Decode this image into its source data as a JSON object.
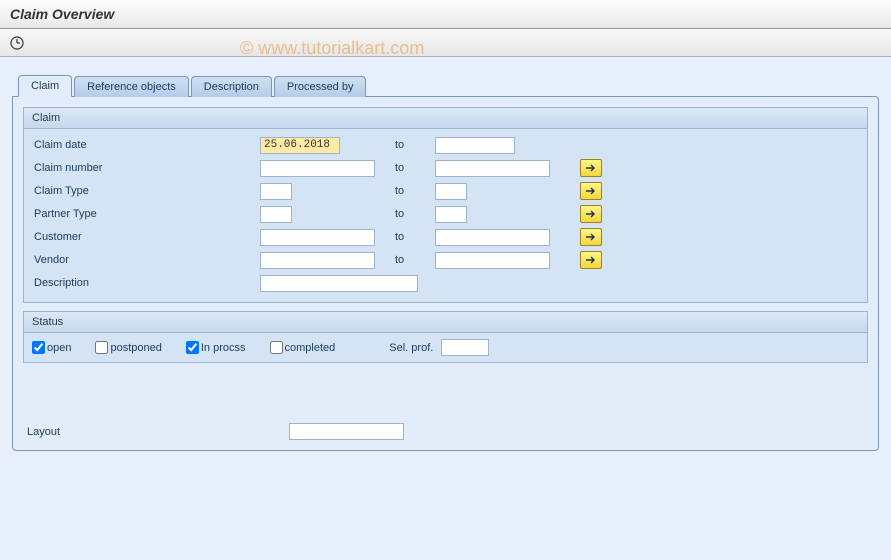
{
  "header": {
    "title": "Claim Overview"
  },
  "watermark": "© www.tutorialkart.com",
  "tabs": [
    {
      "label": "Claim",
      "active": true
    },
    {
      "label": "Reference objects",
      "active": false
    },
    {
      "label": "Description",
      "active": false
    },
    {
      "label": "Processed by",
      "active": false
    }
  ],
  "claim_group": {
    "title": "Claim",
    "fields": {
      "claim_date": {
        "label": "Claim date",
        "from": "25.06.2018",
        "to": "",
        "to_label": "to"
      },
      "claim_number": {
        "label": "Claim number",
        "from": "",
        "to": "",
        "to_label": "to"
      },
      "claim_type": {
        "label": "Claim Type",
        "from": "",
        "to": "",
        "to_label": "to"
      },
      "partner_type": {
        "label": "Partner Type",
        "from": "",
        "to": "",
        "to_label": "to"
      },
      "customer": {
        "label": "Customer",
        "from": "",
        "to": "",
        "to_label": "to"
      },
      "vendor": {
        "label": "Vendor",
        "from": "",
        "to": "",
        "to_label": "to"
      },
      "description": {
        "label": "Description",
        "value": ""
      }
    }
  },
  "status_group": {
    "title": "Status",
    "open": {
      "label": "open",
      "checked": true
    },
    "postponed": {
      "label": "postponed",
      "checked": false
    },
    "in_process": {
      "label": "In procss",
      "checked": true
    },
    "completed": {
      "label": "completed",
      "checked": false
    },
    "sel_prof": {
      "label": "Sel. prof.",
      "value": ""
    }
  },
  "layout": {
    "label": "Layout",
    "value": ""
  }
}
